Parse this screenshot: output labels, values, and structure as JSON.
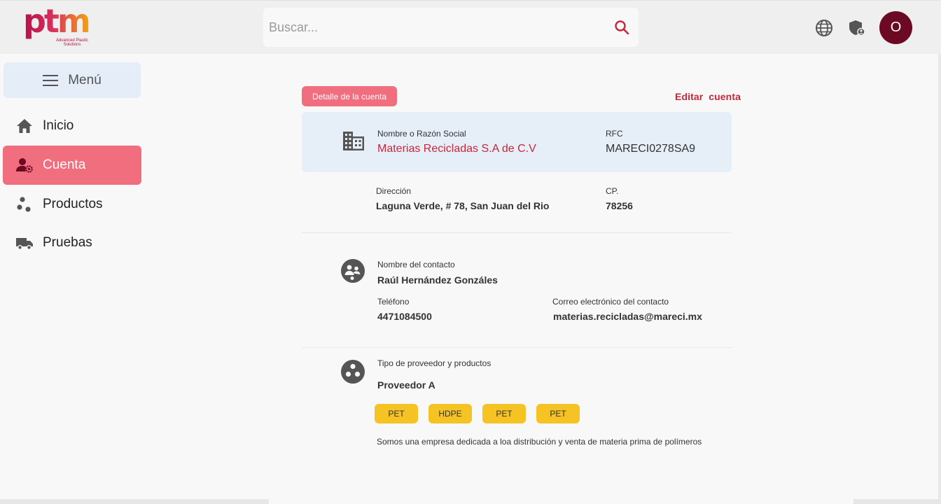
{
  "header": {
    "logo_text": "ptm",
    "logo_tagline": "Advanced Plastic Solutions",
    "search_placeholder": "Buscar...",
    "avatar_initial": "O"
  },
  "sidebar": {
    "menu_label": "Menú",
    "items": [
      {
        "label": "Inicio",
        "icon": "home-icon"
      },
      {
        "label": "Cuenta",
        "icon": "user-settings-icon"
      },
      {
        "label": "Productos",
        "icon": "bubbles-icon"
      },
      {
        "label": "Pruebas",
        "icon": "truck-icon"
      }
    ]
  },
  "account": {
    "badge": "Detalle de la cuenta",
    "edit_label": "Editar  cuenta",
    "company_label": "Nombre o Razón Social",
    "company_value": "Materias Recicladas S.A de C.V",
    "rfc_label": "RFC",
    "rfc_value": "MARECI0278SA9",
    "address_label": "Dirección",
    "address_value": "Laguna Verde, # 78, San Juan del Rio",
    "cp_label": "CP.",
    "cp_value": "78256"
  },
  "contact": {
    "name_label": "Nombre del contacto",
    "name_value": "Raúl Hernández Gonzáles",
    "phone_label": "Teléfono",
    "phone_value": "4471084500",
    "email_label": "Correo electrónico del contacto",
    "email_value": "materias.recicladas@mareci.mx"
  },
  "provider": {
    "type_label": "Tipo de proveedor y productos",
    "type_value": "Proveedor A",
    "chips": [
      "PET",
      "HDPE",
      "PET",
      "PET"
    ],
    "description": "Somos una empresa dedicada a loa distribución y venta de materia prima de polímeros"
  },
  "colors": {
    "accent": "#f16e7e",
    "brand_dark": "#6b0a22",
    "link_red": "#c4283a",
    "chip_yellow": "#f5c324",
    "card_blue": "#e6eef8"
  }
}
